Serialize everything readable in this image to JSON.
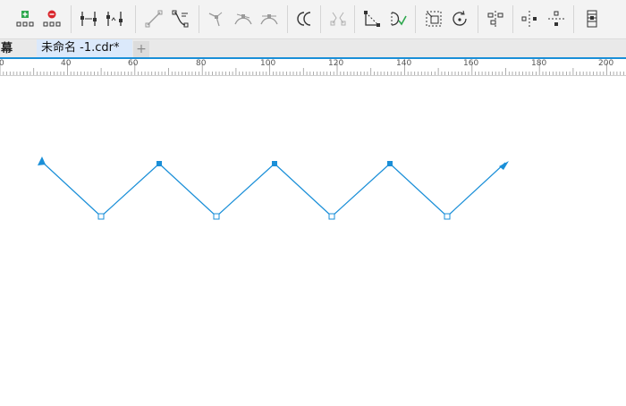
{
  "toolbar": {
    "tools": [
      {
        "name": "add-node-icon",
        "group": 1
      },
      {
        "name": "delete-node-icon",
        "group": 1
      },
      {
        "name": "join-nodes-icon",
        "group": 2
      },
      {
        "name": "break-curve-icon",
        "group": 2
      },
      {
        "name": "convert-to-line-icon",
        "group": 3
      },
      {
        "name": "convert-to-curve-icon",
        "group": 3
      },
      {
        "name": "cusp-node-icon",
        "group": 4
      },
      {
        "name": "smooth-node-icon",
        "group": 4
      },
      {
        "name": "symmetrical-node-icon",
        "group": 4
      },
      {
        "name": "reverse-direction-icon",
        "group": 5
      },
      {
        "name": "extract-subpath-icon",
        "group": 6
      },
      {
        "name": "extend-curve-to-close-icon",
        "group": 7
      },
      {
        "name": "close-curve-icon",
        "group": 7
      },
      {
        "name": "stretch-scale-nodes-icon",
        "group": 8
      },
      {
        "name": "rotate-skew-nodes-icon",
        "group": 8
      },
      {
        "name": "align-nodes-icon",
        "group": 9
      },
      {
        "name": "mirror-horizontal-icon",
        "group": 10
      },
      {
        "name": "mirror-vertical-icon",
        "group": 10
      },
      {
        "name": "elastic-mode-icon",
        "group": 11
      }
    ]
  },
  "tabs": {
    "previous_label": "幕",
    "active_label": "未命名 -1.cdr*",
    "add_label": "+"
  },
  "ruler": {
    "labels": [
      "0",
      "40",
      "60",
      "80",
      "100",
      "120",
      "140",
      "160",
      "180",
      "200"
    ]
  },
  "colors": {
    "path_stroke": "#1a8fd8",
    "accent": "#1a8fd8",
    "add_green": "#2fa84f",
    "delete_red": "#d9262c"
  }
}
